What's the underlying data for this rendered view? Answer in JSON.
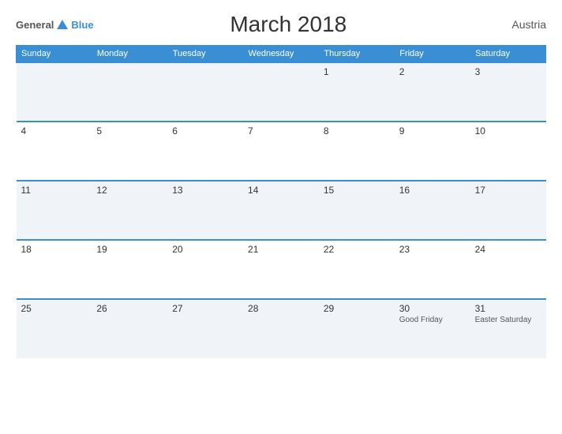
{
  "header": {
    "logo": {
      "general": "General",
      "blue": "Blue",
      "triangle_color": "#3a8fd4"
    },
    "title": "March 2018",
    "country": "Austria"
  },
  "calendar": {
    "weekdays": [
      "Sunday",
      "Monday",
      "Tuesday",
      "Wednesday",
      "Thursday",
      "Friday",
      "Saturday"
    ],
    "weeks": [
      [
        {
          "day": "",
          "event": ""
        },
        {
          "day": "",
          "event": ""
        },
        {
          "day": "",
          "event": ""
        },
        {
          "day": "",
          "event": ""
        },
        {
          "day": "1",
          "event": ""
        },
        {
          "day": "2",
          "event": ""
        },
        {
          "day": "3",
          "event": ""
        }
      ],
      [
        {
          "day": "4",
          "event": ""
        },
        {
          "day": "5",
          "event": ""
        },
        {
          "day": "6",
          "event": ""
        },
        {
          "day": "7",
          "event": ""
        },
        {
          "day": "8",
          "event": ""
        },
        {
          "day": "9",
          "event": ""
        },
        {
          "day": "10",
          "event": ""
        }
      ],
      [
        {
          "day": "11",
          "event": ""
        },
        {
          "day": "12",
          "event": ""
        },
        {
          "day": "13",
          "event": ""
        },
        {
          "day": "14",
          "event": ""
        },
        {
          "day": "15",
          "event": ""
        },
        {
          "day": "16",
          "event": ""
        },
        {
          "day": "17",
          "event": ""
        }
      ],
      [
        {
          "day": "18",
          "event": ""
        },
        {
          "day": "19",
          "event": ""
        },
        {
          "day": "20",
          "event": ""
        },
        {
          "day": "21",
          "event": ""
        },
        {
          "day": "22",
          "event": ""
        },
        {
          "day": "23",
          "event": ""
        },
        {
          "day": "24",
          "event": ""
        }
      ],
      [
        {
          "day": "25",
          "event": ""
        },
        {
          "day": "26",
          "event": ""
        },
        {
          "day": "27",
          "event": ""
        },
        {
          "day": "28",
          "event": ""
        },
        {
          "day": "29",
          "event": ""
        },
        {
          "day": "30",
          "event": "Good Friday"
        },
        {
          "day": "31",
          "event": "Easter Saturday"
        }
      ]
    ]
  }
}
